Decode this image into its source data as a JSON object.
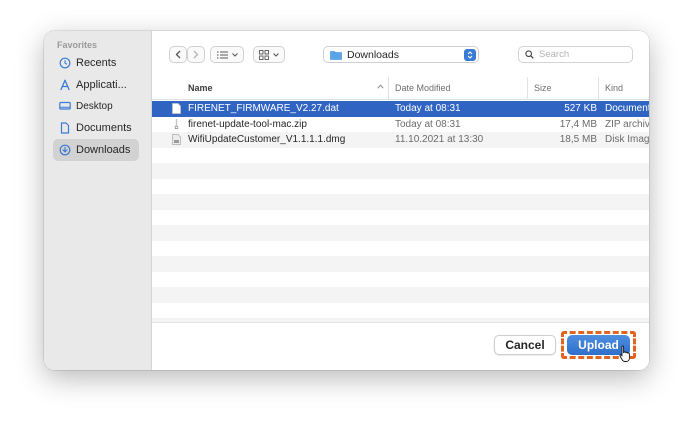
{
  "sidebar": {
    "header": "Favorites",
    "items": [
      {
        "label": "Recents",
        "icon": "clock-icon",
        "selected": false
      },
      {
        "label": "Applicati...",
        "icon": "applications-icon",
        "selected": false
      },
      {
        "label": "Desktop",
        "icon": "desktop-icon",
        "selected": false
      },
      {
        "label": "Documents",
        "icon": "document-icon",
        "selected": false
      },
      {
        "label": "Downloads",
        "icon": "downloads-icon",
        "selected": true
      }
    ]
  },
  "toolbar": {
    "location": "Downloads",
    "search_placeholder": "Search"
  },
  "columns": {
    "name": "Name",
    "date": "Date Modified",
    "size": "Size",
    "kind": "Kind"
  },
  "files": [
    {
      "name": "FIRENET_FIRMWARE_V2.27.dat",
      "date": "Today at 08:31",
      "size": "527 KB",
      "kind": "Document",
      "icon": "file-icon",
      "selected": true
    },
    {
      "name": "firenet-update-tool-mac.zip",
      "date": "Today at 08:31",
      "size": "17,4 MB",
      "kind": "ZIP archive",
      "icon": "zip-file-icon",
      "selected": false
    },
    {
      "name": "WifiUpdateCustomer_V1.1.1.1.dmg",
      "date": "11.10.2021 at 13:30",
      "size": "18,5 MB",
      "kind": "Disk Image",
      "icon": "disk-image-icon",
      "selected": false
    }
  ],
  "footer": {
    "cancel_label": "Cancel",
    "upload_label": "Upload"
  },
  "colors": {
    "selection": "#2f64c2",
    "primary_button": "#3a7bd5",
    "highlight": "#e2641f"
  }
}
